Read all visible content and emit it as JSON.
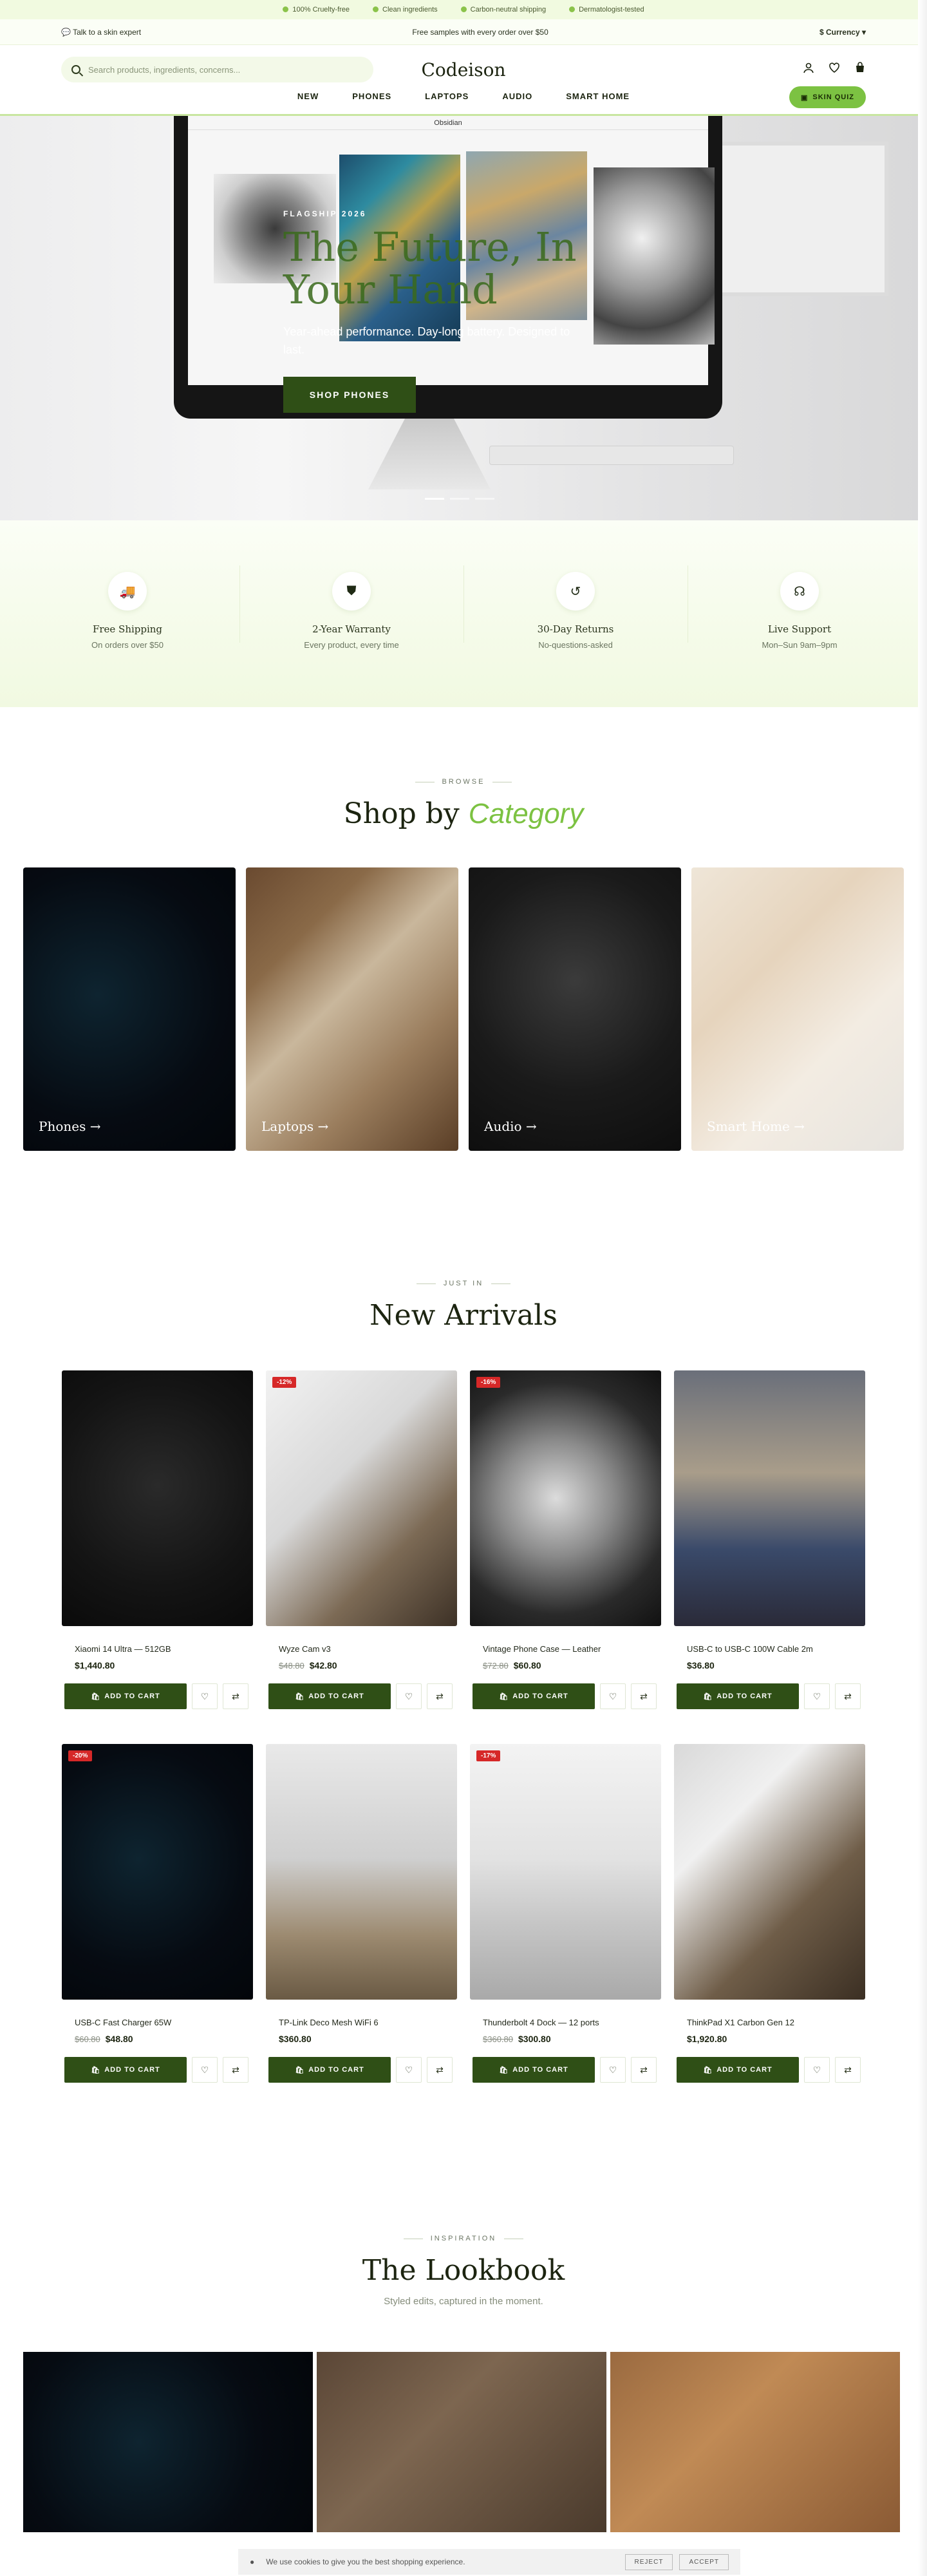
{
  "announcement": {
    "items": [
      "100% Cruelty-free",
      "Clean ingredients",
      "Carbon-neutral shipping",
      "Dermatologist-tested"
    ]
  },
  "subbar": {
    "left": "Talk to a skin expert",
    "center": "Free samples with every order over $50",
    "currency": "$ Currency"
  },
  "header": {
    "search_placeholder": "Search products, ingredients, concerns...",
    "logo": "Codeison",
    "nav": [
      "NEW",
      "PHONES",
      "LAPTOPS",
      "AUDIO",
      "SMART HOME"
    ],
    "quiz_label": "SKIN QUIZ"
  },
  "hero": {
    "screen_title": "Obsidian",
    "kicker": "FLAGSHIP 2026",
    "title": "The Future, In Your Hand",
    "subtitle": "Year-ahead performance. Day-long battery. Designed to last.",
    "button": "SHOP PHONES"
  },
  "features": [
    {
      "title": "Free Shipping",
      "sub": "On orders over $50",
      "icon": "truck-icon"
    },
    {
      "title": "2-Year Warranty",
      "sub": "Every product, every time",
      "icon": "shield-icon"
    },
    {
      "title": "30-Day Returns",
      "sub": "No-questions-asked",
      "icon": "return-icon"
    },
    {
      "title": "Live Support",
      "sub": "Mon–Sun 9am–9pm",
      "icon": "headset-icon"
    }
  ],
  "categories": {
    "kicker": "BROWSE",
    "title_prefix": "Shop by",
    "title_em": "Category",
    "items": [
      "Phones →",
      "Laptops →",
      "Audio →",
      "Smart Home →"
    ]
  },
  "arrivals": {
    "kicker": "JUST IN",
    "title": "New Arrivals",
    "add_label": "ADD TO CART",
    "products": [
      {
        "name": "Xiaomi 14 Ultra — 512GB",
        "price": "$1,440.80",
        "old": "",
        "badge": ""
      },
      {
        "name": "Wyze Cam v3",
        "price": "$42.80",
        "old": "$48.80",
        "badge": "-12%"
      },
      {
        "name": "Vintage Phone Case — Leather",
        "price": "$60.80",
        "old": "$72.80",
        "badge": "-16%"
      },
      {
        "name": "USB-C to USB-C 100W Cable 2m",
        "price": "$36.80",
        "old": "",
        "badge": ""
      },
      {
        "name": "USB-C Fast Charger 65W",
        "price": "$48.80",
        "old": "$60.80",
        "badge": "-20%"
      },
      {
        "name": "TP-Link Deco Mesh WiFi 6",
        "price": "$360.80",
        "old": "",
        "badge": ""
      },
      {
        "name": "Thunderbolt 4 Dock — 12 ports",
        "price": "$300.80",
        "old": "$360.80",
        "badge": "-17%"
      },
      {
        "name": "ThinkPad X1 Carbon Gen 12",
        "price": "$1,920.80",
        "old": "",
        "badge": ""
      }
    ]
  },
  "lookbook": {
    "kicker": "INSPIRATION",
    "title": "The Lookbook",
    "subtitle": "Styled edits, captured in the moment."
  },
  "cookie": {
    "text": "We use cookies to give you the best shopping experience.",
    "reject": "REJECT",
    "accept": "ACCEPT"
  }
}
